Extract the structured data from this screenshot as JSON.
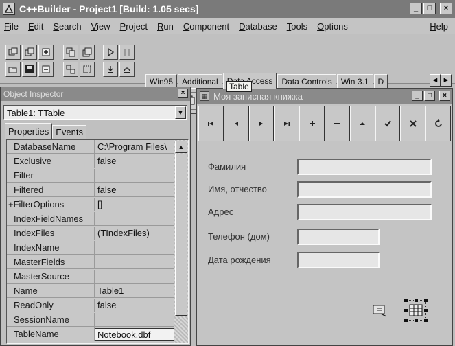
{
  "window": {
    "title": "C++Builder - Project1 [Build: 1.05 secs]",
    "buttons": {
      "minimize": "_",
      "maximize": "□",
      "close": "×"
    }
  },
  "menu": [
    "File",
    "Edit",
    "Search",
    "View",
    "Project",
    "Run",
    "Component",
    "Database",
    "Tools",
    "Options",
    "Help"
  ],
  "palette": {
    "tabs": [
      "Win95",
      "Additional",
      "Data Access",
      "Data Controls",
      "Win 3.1",
      "D"
    ],
    "active_tab": "Data Access",
    "scroll_left": "◄",
    "scroll_right": "►",
    "tooltip": "Table",
    "components": [
      "pointer-icon",
      "datasource-icon",
      "table-icon",
      "query-icon",
      "storedproc-icon",
      "database-icon",
      "batchmove-icon",
      "updatesql-icon",
      "session-icon"
    ]
  },
  "object_inspector": {
    "title": "Object Inspector",
    "close": "×",
    "selected_object": "Table1: TTable",
    "tabs": [
      "Properties",
      "Events"
    ],
    "properties": [
      {
        "name": "DatabaseName",
        "value": "C:\\Program Files\\"
      },
      {
        "name": "Exclusive",
        "value": "false"
      },
      {
        "name": "Filter",
        "value": ""
      },
      {
        "name": "Filtered",
        "value": "false"
      },
      {
        "name": "+FilterOptions",
        "value": "[]"
      },
      {
        "name": "IndexFieldNames",
        "value": ""
      },
      {
        "name": "IndexFiles",
        "value": "(TIndexFiles)"
      },
      {
        "name": "IndexName",
        "value": ""
      },
      {
        "name": "MasterFields",
        "value": ""
      },
      {
        "name": "MasterSource",
        "value": ""
      },
      {
        "name": "Name",
        "value": "Table1"
      },
      {
        "name": "ReadOnly",
        "value": "false"
      },
      {
        "name": "SessionName",
        "value": ""
      },
      {
        "name": "TableName",
        "value": "Notebook.dbf"
      }
    ]
  },
  "form": {
    "title": "Моя записная книжка",
    "navigator": [
      "first",
      "prior",
      "next",
      "last",
      "insert",
      "delete",
      "edit",
      "post",
      "cancel",
      "refresh"
    ],
    "fields": [
      {
        "label": "Фамилия"
      },
      {
        "label": "Имя, отчество"
      },
      {
        "label": "Адрес"
      },
      {
        "label": "Телефон (дом)"
      },
      {
        "label": "Дата рождения"
      }
    ],
    "nonvisual_components": [
      "datasource-component-icon",
      "table-component-icon"
    ]
  }
}
